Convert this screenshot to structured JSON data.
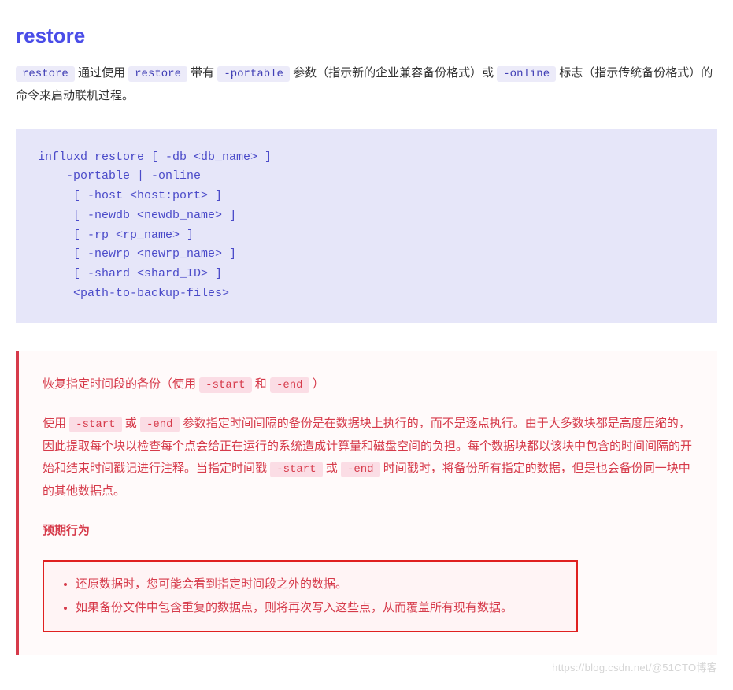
{
  "heading": "restore",
  "intro": {
    "t1": "restore",
    "t2": " 通过使用 ",
    "t3": "restore",
    "t4": " 带有 ",
    "t5": "-portable",
    "t6": " 参数（指示新的企业兼容备份格式）或 ",
    "t7": "-online",
    "t8": " 标志（指示传统备份格式）的命令来启动联机过程。"
  },
  "code": "influxd restore [ -db <db_name> ]\n    -portable | -online\n     [ -host <host:port> ]\n     [ -newdb <newdb_name> ]\n     [ -rp <rp_name> ]\n     [ -newrp <newrp_name> ]\n     [ -shard <shard_ID> ]\n     <path-to-backup-files>",
  "note": {
    "p1a": "恢复指定时间段的备份（使用 ",
    "p1b": "-start",
    "p1c": " 和 ",
    "p1d": "-end",
    "p1e": " ）",
    "p2a": "使用 ",
    "p2b": "-start",
    "p2c": " 或 ",
    "p2d": "-end",
    "p2e": " 参数指定时间间隔的备份是在数据块上执行的，而不是逐点执行。由于大多数块都是高度压缩的，因此提取每个块以检查每个点会给正在运行的系统造成计算量和磁盘空间的负担。每个数据块都以该块中包含的时间间隔的开始和结束时间戳记进行注释。当指定时间戳 ",
    "p2f": "-start",
    "p2g": " 或 ",
    "p2h": "-end",
    "p2i": " 时间戳时，将备份所有指定的数据，但是也会备份同一块中的其他数据点。",
    "p3": "预期行为",
    "li1": "还原数据时，您可能会看到指定时间段之外的数据。",
    "li2": "如果备份文件中包含重复的数据点，则将再次写入这些点，从而覆盖所有现有数据。"
  },
  "watermark": "https://blog.csdn.net/@51CTO博客"
}
